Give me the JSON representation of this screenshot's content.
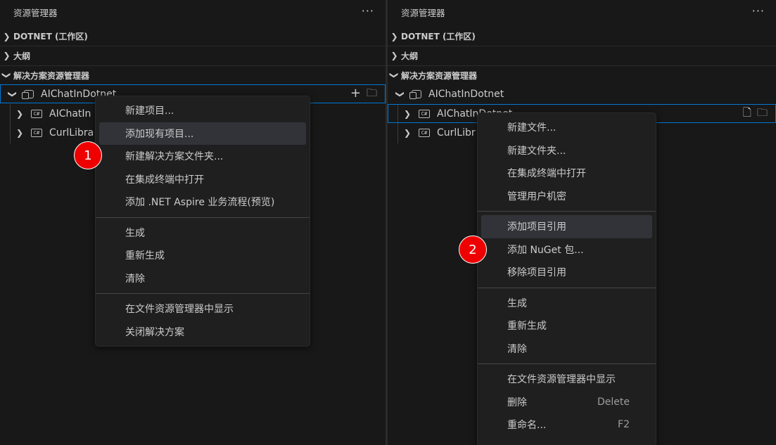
{
  "left": {
    "view_title": "资源管理器",
    "more": "···",
    "sections": {
      "workspace": "DOTNET (工作区)",
      "outline": "大纲",
      "solution_explorer": "解决方案资源管理器"
    },
    "tree": {
      "solution": "AIChatInDotnet",
      "project1": "AIChatIn",
      "project2": "CurlLibra",
      "cs_icon": "C#"
    },
    "context_menu": {
      "group1": [
        "新建项目...",
        "添加现有项目...",
        "新建解决方案文件夹...",
        "在集成终端中打开",
        "添加 .NET Aspire 业务流程(预览)"
      ],
      "group2": [
        "生成",
        "重新生成",
        "清除"
      ],
      "group3": [
        "在文件资源管理器中显示",
        "关闭解决方案"
      ]
    },
    "badge": "1"
  },
  "right": {
    "view_title": "资源管理器",
    "more": "···",
    "sections": {
      "workspace": "DOTNET (工作区)",
      "outline": "大纲",
      "solution_explorer": "解决方案资源管理器"
    },
    "tree": {
      "solution": "AIChatInDotnet",
      "project1": "AIChatInDotnet",
      "project2": "CurlLibr",
      "cs_icon": "C#"
    },
    "context_menu": {
      "group1": [
        "新建文件...",
        "新建文件夹...",
        "在集成终端中打开",
        "管理用户机密"
      ],
      "group2": [
        "添加项目引用",
        "添加 NuGet 包...",
        "移除项目引用"
      ],
      "group3": [
        "生成",
        "重新生成",
        "清除"
      ],
      "group4": [
        "在文件资源管理器中显示",
        "删除",
        "重命名..."
      ],
      "shortcuts": {
        "delete": "Delete",
        "rename": "F2"
      }
    },
    "badge": "2"
  },
  "colors": {
    "background": "#181818",
    "menu_bg": "#1f1f1f",
    "hover": "#313338",
    "focus_border": "#0078d4",
    "badge": "#ee0000"
  }
}
